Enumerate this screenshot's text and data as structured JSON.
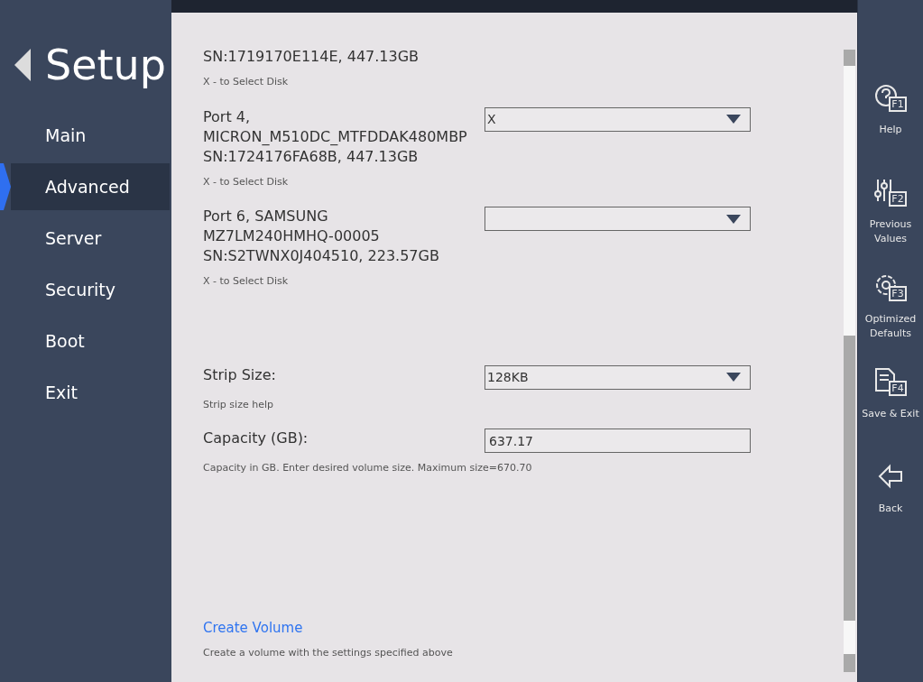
{
  "header": {
    "title": "Setup"
  },
  "sidebar": {
    "items": [
      {
        "label": "Main",
        "selected": false
      },
      {
        "label": "Advanced",
        "selected": true
      },
      {
        "label": "Server",
        "selected": false
      },
      {
        "label": "Security",
        "selected": false
      },
      {
        "label": "Boot",
        "selected": false
      },
      {
        "label": "Exit",
        "selected": false
      }
    ]
  },
  "settings": [
    {
      "kind": "info",
      "label": "SN:1719170E114E, 447.13GB",
      "help": "X - to Select Disk"
    },
    {
      "kind": "select",
      "label": "Port 4,\nMICRON_M510DC_MTFDDAK480MBP\nSN:1724176FA68B, 447.13GB",
      "value": "X",
      "help": "X - to Select Disk"
    },
    {
      "kind": "select",
      "label": "Port 6, SAMSUNG\nMZ7LM240HMHQ-00005\nSN:S2TWNX0J404510, 223.57GB",
      "help": "X - to Select Disk"
    },
    {
      "kind": "select",
      "label": "Strip Size:",
      "value": "128KB",
      "help": "Strip size help"
    },
    {
      "kind": "input",
      "label": "Capacity (GB):",
      "value": "637.17",
      "help": "Capacity in GB. Enter desired volume size. Maximum size=670.70"
    },
    {
      "kind": "action",
      "label": "Create Volume",
      "help": "Create a volume with the settings specified above"
    }
  ],
  "actions": [
    {
      "kind": "help",
      "key": "F1",
      "label": "Help"
    },
    {
      "kind": "previous",
      "key": "F2",
      "label": "Previous\nValues"
    },
    {
      "kind": "defaults",
      "key": "F3",
      "label": "Optimized\nDefaults"
    },
    {
      "kind": "save",
      "key": "F4",
      "label": "Save & Exit"
    },
    {
      "kind": "back",
      "label": "Back"
    }
  ]
}
